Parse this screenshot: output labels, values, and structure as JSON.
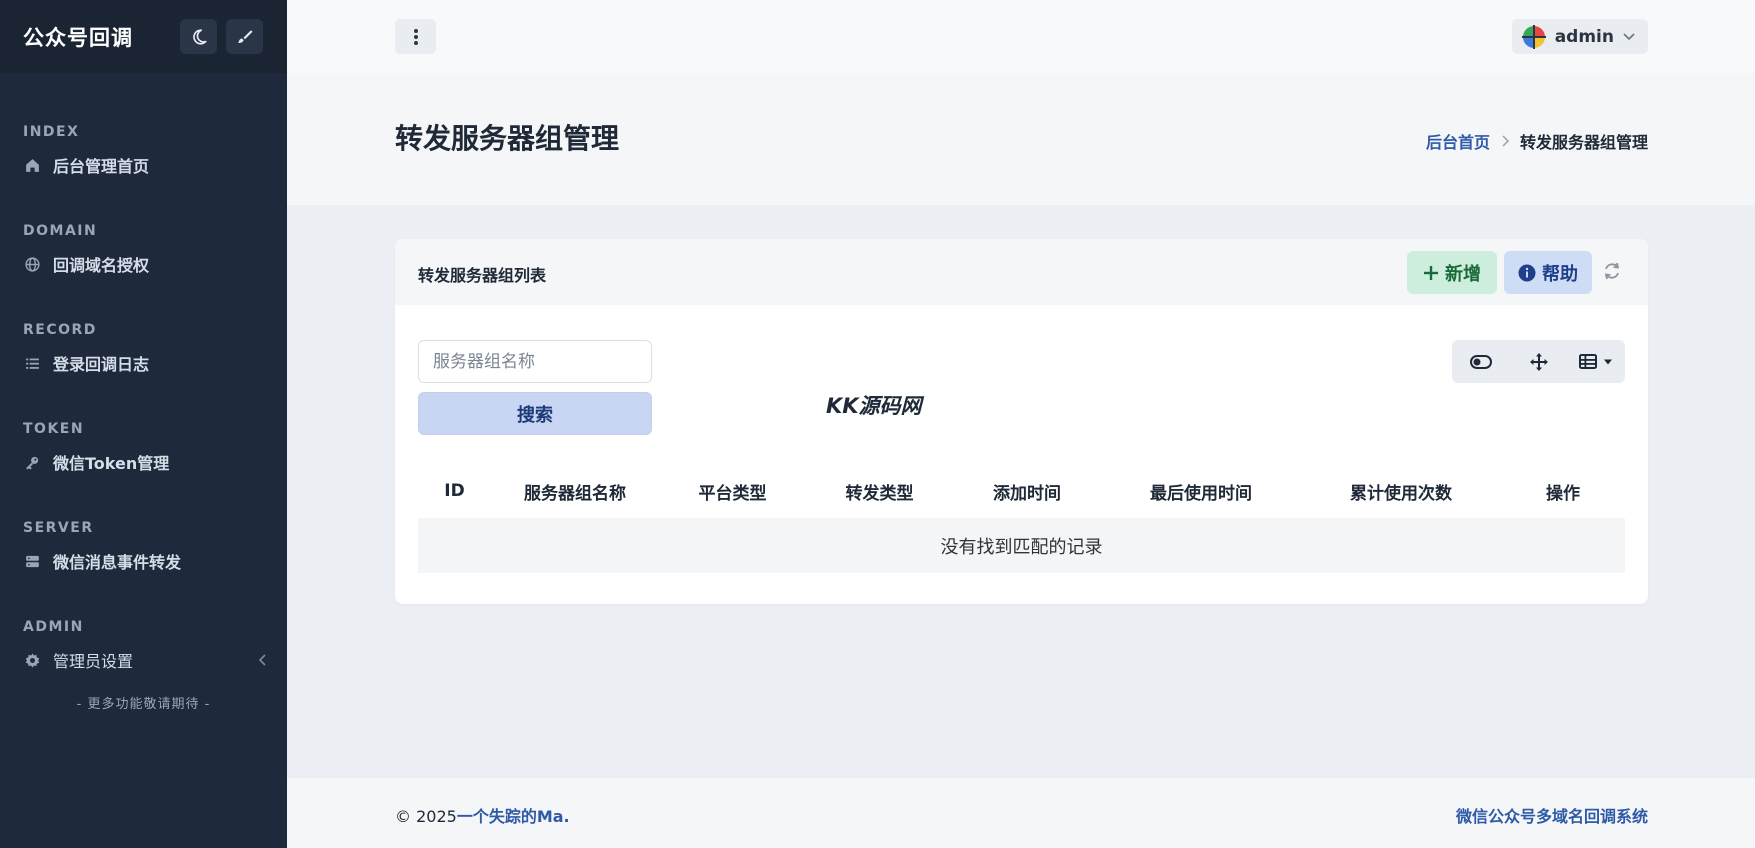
{
  "sidebar": {
    "brand": "公众号回调",
    "sections": [
      {
        "heading": "INDEX",
        "item": "后台管理首页",
        "icon": "home-icon"
      },
      {
        "heading": "DOMAIN",
        "item": "回调域名授权",
        "icon": "globe-icon"
      },
      {
        "heading": "RECORD",
        "item": "登录回调日志",
        "icon": "list-icon"
      },
      {
        "heading": "TOKEN",
        "item": "微信Token管理",
        "icon": "key-icon"
      },
      {
        "heading": "SERVER",
        "item": "微信消息事件转发",
        "icon": "server-icon"
      },
      {
        "heading": "ADMIN",
        "item": "管理员设置",
        "icon": "gear-icon"
      }
    ],
    "footer_note": "- 更多功能敬请期待 -"
  },
  "topbar": {
    "user_name": "admin"
  },
  "page": {
    "title": "转发服务器组管理",
    "breadcrumb_home": "后台首页",
    "breadcrumb_current": "转发服务器组管理"
  },
  "card": {
    "title": "转发服务器组列表",
    "add_label": "新增",
    "help_label": "帮助",
    "search_placeholder": "服务器组名称",
    "search_label": "搜索",
    "watermark": "KK源码网",
    "columns": [
      "ID",
      "服务器组名称",
      "平台类型",
      "转发类型",
      "添加时间",
      "最后使用时间",
      "累计使用次数",
      "操作"
    ],
    "empty_text": "没有找到匹配的记录"
  },
  "footer": {
    "copyright": "© 2025",
    "author": "一个失踪的Ma.",
    "system_name": "微信公众号多域名回调系统"
  },
  "colors": {
    "sidebar_bg": "#1e293b",
    "accent": "#2f5aa8",
    "add_bg": "#cdeedd",
    "help_bg": "#cfdcf5"
  }
}
